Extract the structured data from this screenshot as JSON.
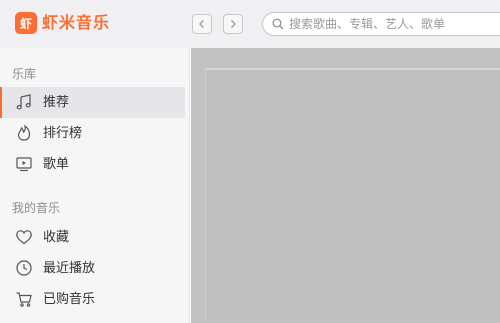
{
  "app": {
    "logo_char": "虾",
    "name": "虾米音乐"
  },
  "search": {
    "placeholder": "搜索歌曲、专辑、艺人、歌单"
  },
  "sidebar": {
    "library_title": "乐库",
    "library_items": [
      {
        "label": "推荐",
        "icon": "music-note-icon",
        "active": true
      },
      {
        "label": "排行榜",
        "icon": "flame-icon",
        "active": false
      },
      {
        "label": "歌单",
        "icon": "playlist-screen-icon",
        "active": false
      }
    ],
    "my_music_title": "我的音乐",
    "my_music_items": [
      {
        "label": "收藏",
        "icon": "heart-icon"
      },
      {
        "label": "最近播放",
        "icon": "clock-icon"
      },
      {
        "label": "已购音乐",
        "icon": "cart-icon"
      }
    ]
  },
  "colors": {
    "accent": "#ff6d32",
    "sidebar_bg": "#f6f6f7",
    "topbar_bg": "#f0f0f2",
    "content_bg": "#c2c2c2"
  }
}
